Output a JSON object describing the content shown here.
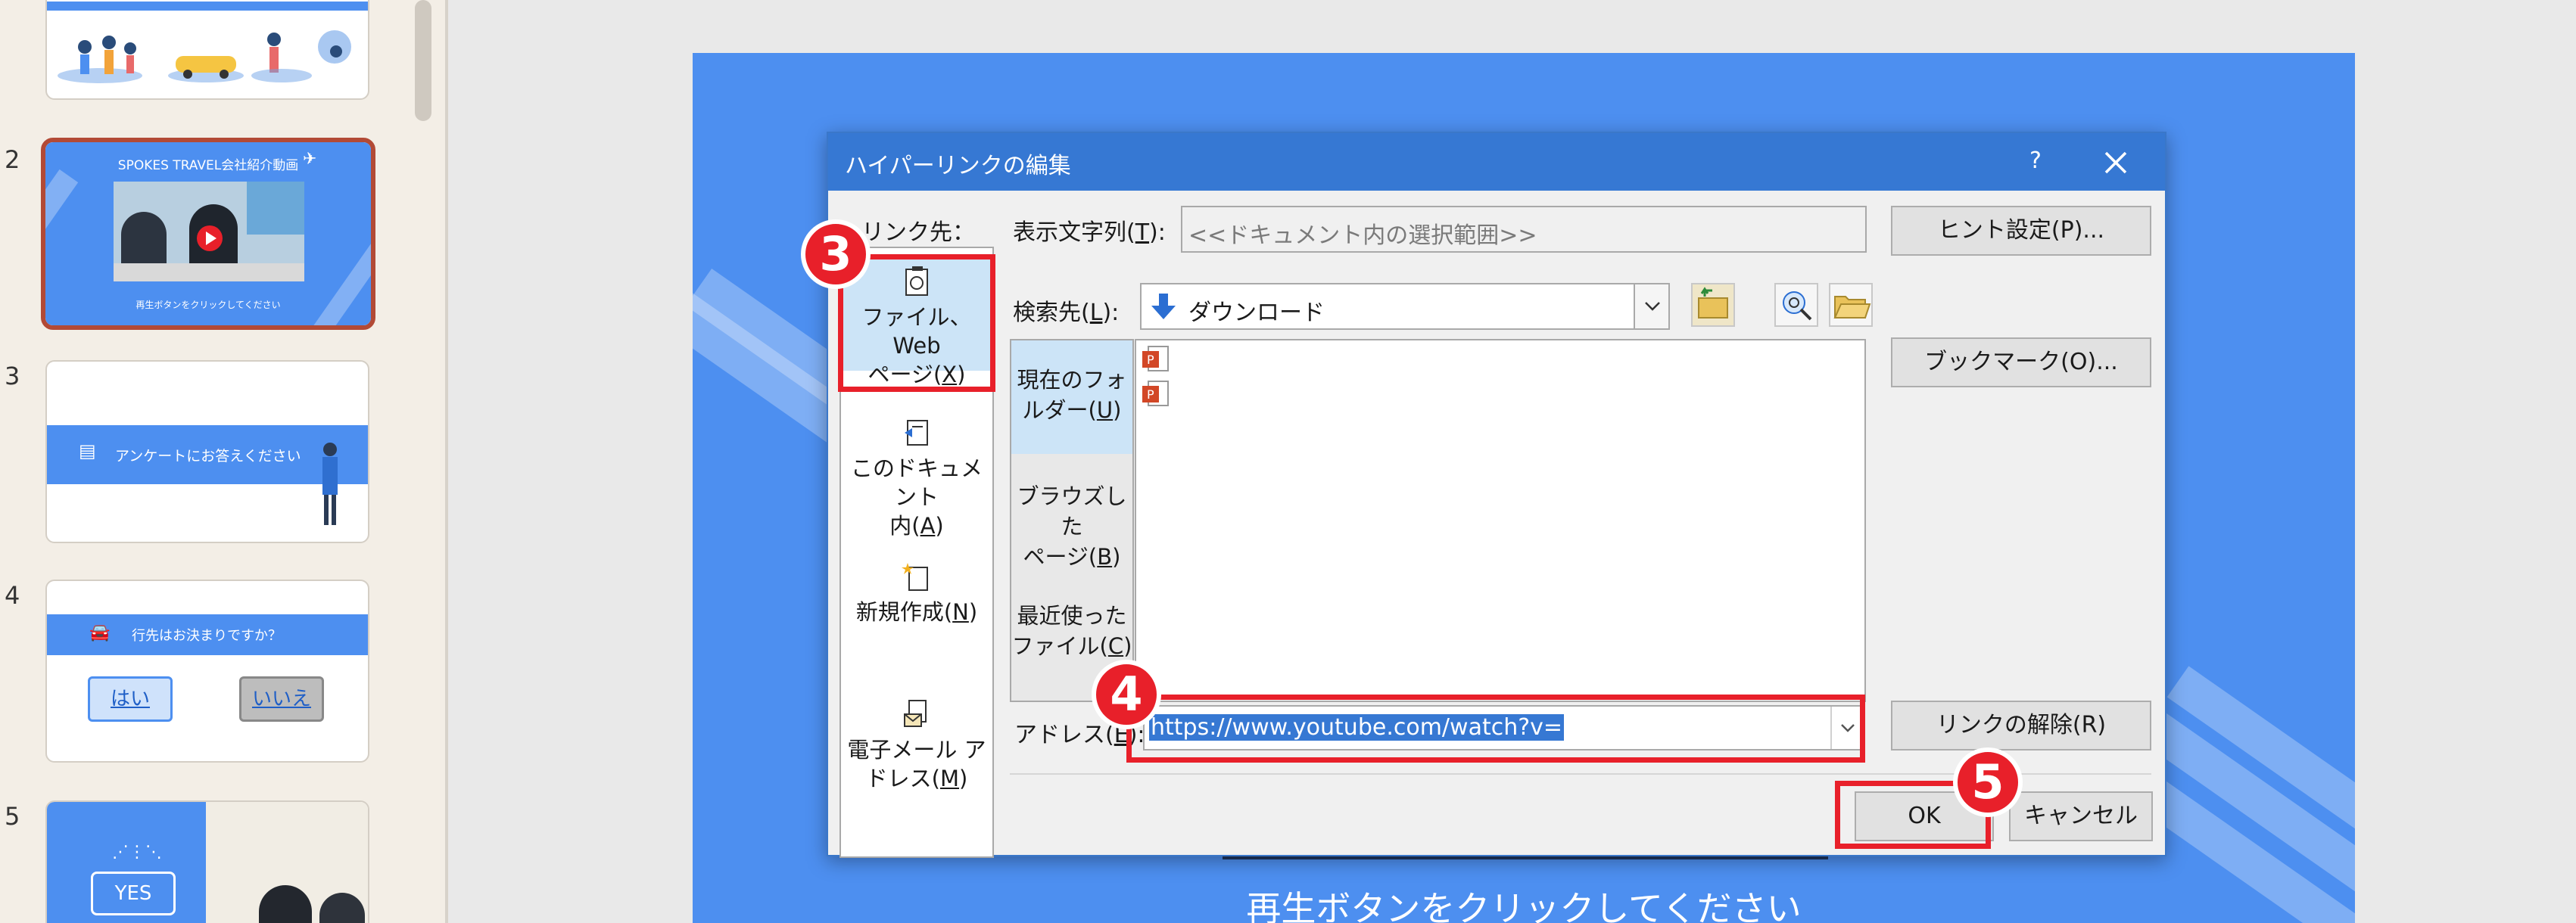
{
  "thumbnails": {
    "items": [
      {
        "number": "",
        "type": "illustration"
      },
      {
        "number": "2",
        "title": "SPOKES TRAVEL会社紹介動画",
        "caption": "再生ボタンをクリックしてください",
        "selected": true
      },
      {
        "number": "3",
        "banner": "アンケートにお答えください"
      },
      {
        "number": "4",
        "banner": "行先はお決まりですか？",
        "yes": "はい",
        "no": "いいえ"
      },
      {
        "number": "5",
        "yes": "YES"
      }
    ]
  },
  "slide": {
    "caption": "再生ボタンをクリックしてください",
    "bg_color": "#4d8ff0"
  },
  "dialog": {
    "title": "ハイパーリンクの編集",
    "help": "?",
    "link_to_label": "リンク先：",
    "link_to_items": [
      {
        "line1": "ファイル、Web",
        "line2": "ページ(",
        "key": "X",
        "tail": ")",
        "active": true
      },
      {
        "line1": "このドキュメント",
        "line2": "内(",
        "key": "A",
        "tail": ")"
      },
      {
        "line1": "新規作成(",
        "key": "N",
        "tail": ")"
      },
      {
        "line1": "電子メール ア",
        "line2": "ドレス(",
        "key": "M",
        "tail": ")"
      }
    ],
    "display_text_label": "表示文字列(",
    "display_text_key": "T",
    "display_text_tail": "):",
    "display_text_value": "<<ドキュメント内の選択範囲>>",
    "screentip_button": "ヒント設定(P)...",
    "look_in_label": "検索先(",
    "look_in_key": "L",
    "look_in_tail": "):",
    "look_in_value": "ダウンロード",
    "lookin_tabs": [
      {
        "line1": "現在のフォ",
        "line2": "ルダー(",
        "key": "U",
        "tail": ")",
        "active": true
      },
      {
        "line1": "ブラウズした",
        "line2": "ページ(",
        "key": "B",
        "tail": ")"
      },
      {
        "line1": "最近使った",
        "line2": "ファイル(",
        "key": "C",
        "tail": ")"
      }
    ],
    "bookmark_button": "ブックマーク(O)...",
    "address_label": "アドレス(",
    "address_key": "E",
    "address_tail": "):",
    "address_value": "https://www.youtube.com/watch?v=",
    "remove_link_button": "リンクの解除(R)",
    "ok_button": "OK",
    "cancel_button": "キャンセル"
  },
  "annotations": {
    "badge3": "3",
    "badge4": "4",
    "badge5": "5",
    "highlight_color": "#e8202a"
  }
}
